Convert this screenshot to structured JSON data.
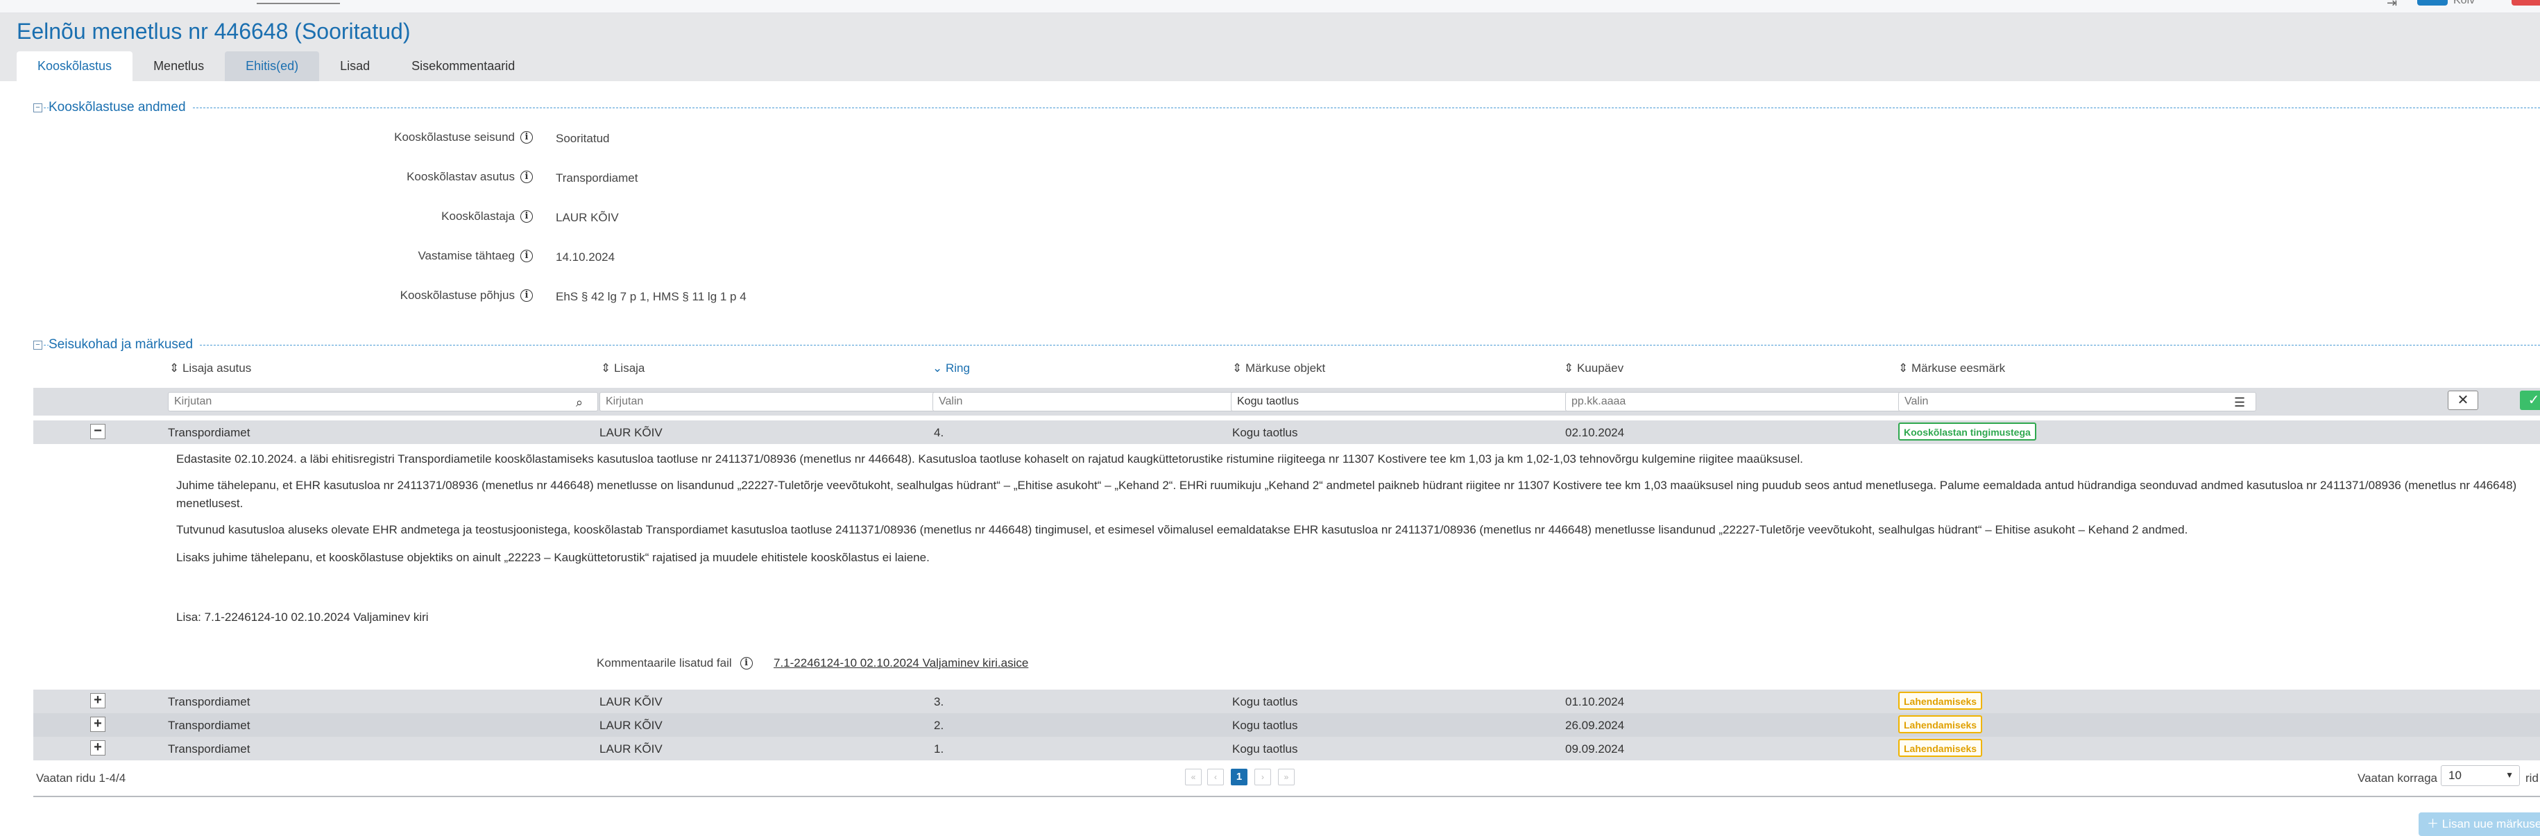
{
  "title": "Eelnõu menetlus nr 446648 (Sooritatud)",
  "top_bar": {
    "user_label": "Kõiv"
  },
  "tabs": [
    {
      "label": "Kooskõlastus",
      "active": true
    },
    {
      "label": "Menetlus"
    },
    {
      "label": "Ehitis(ed)"
    },
    {
      "label": "Lisad"
    },
    {
      "label": "Sisekommentaarid"
    }
  ],
  "section1": {
    "title": "Kooskõlastuse andmed",
    "fields": [
      {
        "label": "Kooskõlastuse seisund",
        "value": "Sooritatud"
      },
      {
        "label": "Kooskõlastav asutus",
        "value": "Transpordiamet"
      },
      {
        "label": "Kooskõlastaja",
        "value": "LAUR KÕIV"
      },
      {
        "label": "Vastamise tähtaeg",
        "value": "14.10.2024"
      },
      {
        "label": "Kooskõlastuse põhjus",
        "value": "EhS § 42 lg 7 p 1, HMS § 11 lg 1 p 4"
      }
    ]
  },
  "section2": {
    "title": "Seisukohad ja märkused",
    "columns": [
      {
        "label": "Lisaja asutus"
      },
      {
        "label": "Lisaja"
      },
      {
        "label": "Ring",
        "sorted": true
      },
      {
        "label": "Märkuse objekt"
      },
      {
        "label": "Kuupäev"
      },
      {
        "label": "Märkuse eesmärk"
      }
    ],
    "filters": {
      "asutus_placeholder": "Kirjutan",
      "lisaja_placeholder": "Kirjutan",
      "ring_placeholder": "Valin",
      "objekt_value": "Kogu taotlus",
      "kuupaev_placeholder": "pp.kk.aaaa",
      "eesmark_placeholder": "Valin"
    },
    "expanded_row": {
      "asutus": "Transpordiamet",
      "lisaja": "LAUR KÕIV",
      "ring": "4.",
      "objekt": "Kogu taotlus",
      "kuupaev": "02.10.2024",
      "eesmark": "Kooskõlastan tingimustega",
      "expand_symbol": "−",
      "paragraphs": [
        "Edastasite 02.10.2024. a läbi ehitisregistri Transpordiametile kooskõlastamiseks kasutusloa taotluse nr 2411371/08936 (menetlus nr 446648). Kasutusloa taotluse kohaselt on rajatud kaugküttetorustike ristumine riigiteega nr 11307 Kostivere tee km 1,03 ja km 1,02-1,03 tehnovõrgu kulgemine riigitee maaüksusel.",
        "Juhime tähelepanu, et EHR kasutusloa nr 2411371/08936 (menetlus nr 446648) menetlusse on lisandunud „22227-Tuletõrje veevõtukoht, sealhulgas hüdrant“ – „Ehitise asukoht“ – „Kehand 2“. EHRi ruumikuju „Kehand 2“ andmetel paikneb hüdrant riigitee nr 11307 Kostivere tee km 1,03 maaüksusel ning puudub seos antud menetlusega. Palume eemaldada antud hüdrandiga seonduvad andmed kasutusloa nr 2411371/08936 (menetlus nr 446648) menetlusest.",
        "Tutvunud kasutusloa aluseks olevate EHR andmetega ja teostusjoonistega, kooskõlastab Transpordiamet kasutusloa taotluse 2411371/08936 (menetlus nr 446648) tingimusel, et esimesel võimalusel eemaldatakse EHR kasutusloa nr 2411371/08936 (menetlus nr 446648) menetlusse lisandunud „22227-Tuletõrje veevõtukoht, sealhulgas hüdrant“ – Ehitise asukoht – Kehand 2 andmed.",
        "Lisaks juhime tähelepanu, et kooskõlastuse objektiks on ainult „22223 – Kaugküttetorustik“ rajatised ja muudele ehitistele kooskõlastus ei laiene.",
        "Lisa: 7.1-2246124-10 02.10.2024 Valjaminev kiri"
      ],
      "file_label": "Kommentaarile lisatud fail",
      "file_name": "7.1-2246124-10 02.10.2024 Valjaminev kiri.asice"
    },
    "rows": [
      {
        "asutus": "Transpordiamet",
        "lisaja": "LAUR KÕIV",
        "ring": "3.",
        "objekt": "Kogu taotlus",
        "kuupaev": "01.10.2024",
        "eesmark": "Lahendamiseks",
        "expand_symbol": "+"
      },
      {
        "asutus": "Transpordiamet",
        "lisaja": "LAUR KÕIV",
        "ring": "2.",
        "objekt": "Kogu taotlus",
        "kuupaev": "26.09.2024",
        "eesmark": "Lahendamiseks",
        "expand_symbol": "+"
      },
      {
        "asutus": "Transpordiamet",
        "lisaja": "LAUR KÕIV",
        "ring": "1.",
        "objekt": "Kogu taotlus",
        "kuupaev": "09.09.2024",
        "eesmark": "Lahendamiseks",
        "expand_symbol": "+"
      }
    ],
    "footer": {
      "count_text": "Vaatan ridu 1-4/4",
      "current_page": "1",
      "page_size_label": "Vaatan korraga",
      "page_size_value": "10",
      "page_size_suffix": "rid",
      "add_button": "Lisan uue märkuse"
    }
  },
  "colors": {
    "accent": "#1a6fb0",
    "badge_green": "#2fa84f",
    "badge_yellow": "#f0b400",
    "row_bg": "#dcdee2"
  }
}
